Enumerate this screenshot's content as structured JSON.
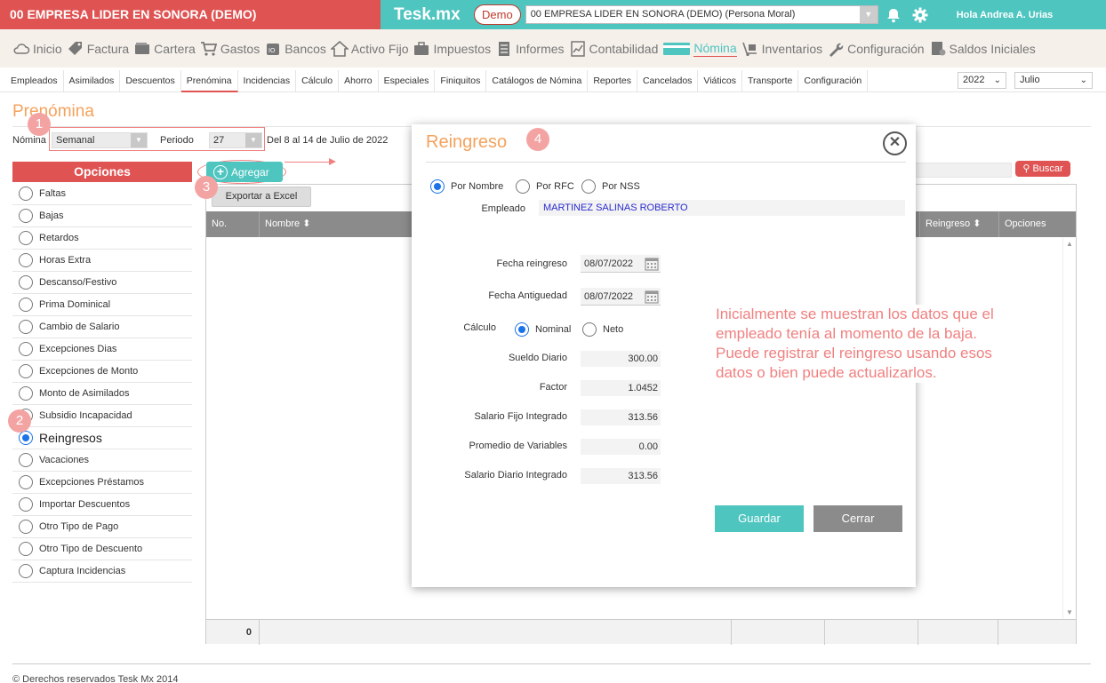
{
  "topbar": {
    "company": "00 EMPRESA LIDER EN SONORA (DEMO)",
    "brand": "Tesk.mx",
    "demo": "Demo",
    "company_select": "00 EMPRESA LIDER EN SONORA (DEMO) (Persona Moral)",
    "greeting": "Hola Andrea A. Urias"
  },
  "main_menu": [
    {
      "label": "Inicio",
      "icon": "cloud-icon"
    },
    {
      "label": "Factura",
      "icon": "tag-icon"
    },
    {
      "label": "Cartera",
      "icon": "wallet-icon"
    },
    {
      "label": "Gastos",
      "icon": "cart-icon"
    },
    {
      "label": "Bancos",
      "icon": "bank-icon"
    },
    {
      "label": "Activo Fijo",
      "icon": "house-icon"
    },
    {
      "label": "Impuestos",
      "icon": "briefcase-icon"
    },
    {
      "label": "Informes",
      "icon": "list-icon"
    },
    {
      "label": "Contabilidad",
      "icon": "chart-icon"
    },
    {
      "label": "Nómina",
      "icon": "card-icon"
    },
    {
      "label": "Inventarios",
      "icon": "hand-truck-icon"
    },
    {
      "label": "Configuración",
      "icon": "wrench-icon"
    },
    {
      "label": "Saldos Iniciales",
      "icon": "document-icon"
    }
  ],
  "sub_menu": [
    "Empleados",
    "Asimilados",
    "Descuentos",
    "Prenómina",
    "Incidencias",
    "Cálculo",
    "Ahorro",
    "Especiales",
    "Finiquitos",
    "Catálogos de Nómina",
    "Reportes",
    "Cancelados",
    "Viáticos",
    "Transporte",
    "Configuración"
  ],
  "year": "2022",
  "month": "Julio",
  "page_title": "Prenómina",
  "filters": {
    "nomina_label": "Nómina",
    "nomina_value": "Semanal",
    "periodo_label": "Periodo",
    "periodo_value": "27",
    "range": "Del 8 al 14 de Julio de 2022"
  },
  "badges": [
    "1",
    "2",
    "3",
    "4"
  ],
  "options": {
    "title": "Opciones",
    "items": [
      "Faltas",
      "Bajas",
      "Retardos",
      "Horas Extra",
      "Descanso/Festivo",
      "Prima Dominical",
      "Cambio de Salario",
      "Excepciones Dias",
      "Excepciones de Monto",
      "Monto de Asimilados",
      "Subsidio Incapacidad",
      "Reingresos",
      "Vacaciones",
      "Excepciones Préstamos",
      "Importar Descuentos",
      "Otro Tipo de Pago",
      "Otro Tipo de Descuento",
      "Captura Incidencias"
    ],
    "selected": 11
  },
  "buttons": {
    "add": "Agregar",
    "export": "Exportar a Excel",
    "search": "Buscar"
  },
  "grid": {
    "headers": [
      "No.",
      "Nombre",
      "Reingreso",
      "Opciones"
    ],
    "total": "0"
  },
  "footer": "© Derechos reservados Tesk Mx 2014",
  "modal": {
    "title": "Reingreso",
    "search_by": [
      "Por Nombre",
      "Por RFC",
      "Por NSS"
    ],
    "employee_label": "Empleado",
    "employee": "MARTINEZ SALINAS ROBERTO",
    "fecha_reingreso_label": "Fecha reingreso",
    "fecha_reingreso": "08/07/2022",
    "fecha_antiguedad_label": "Fecha Antiguedad",
    "fecha_antiguedad": "08/07/2022",
    "calculo_label": "Cálculo",
    "calculo_options": [
      "Nominal",
      "Neto"
    ],
    "sueldo_diario_label": "Sueldo Diario",
    "sueldo_diario": "300.00",
    "factor_label": "Factor",
    "factor": "1.0452",
    "sfi_label": "Salario Fijo Integrado",
    "sfi": "313.56",
    "promedio_label": "Promedio de Variables",
    "promedio": "0.00",
    "sdi_label": "Salario Diario Integrado",
    "sdi": "313.56",
    "save": "Guardar",
    "close": "Cerrar"
  },
  "note": "Inicialmente se muestran los datos que el empleado tenía al momento de la baja. Puede registrar el reingreso usando esos datos o bien puede actualizarlos.",
  "colors": {
    "red": "#e05353",
    "teal": "#4fc5c0",
    "orange": "#f5a25c",
    "annotation": "#f08080"
  }
}
